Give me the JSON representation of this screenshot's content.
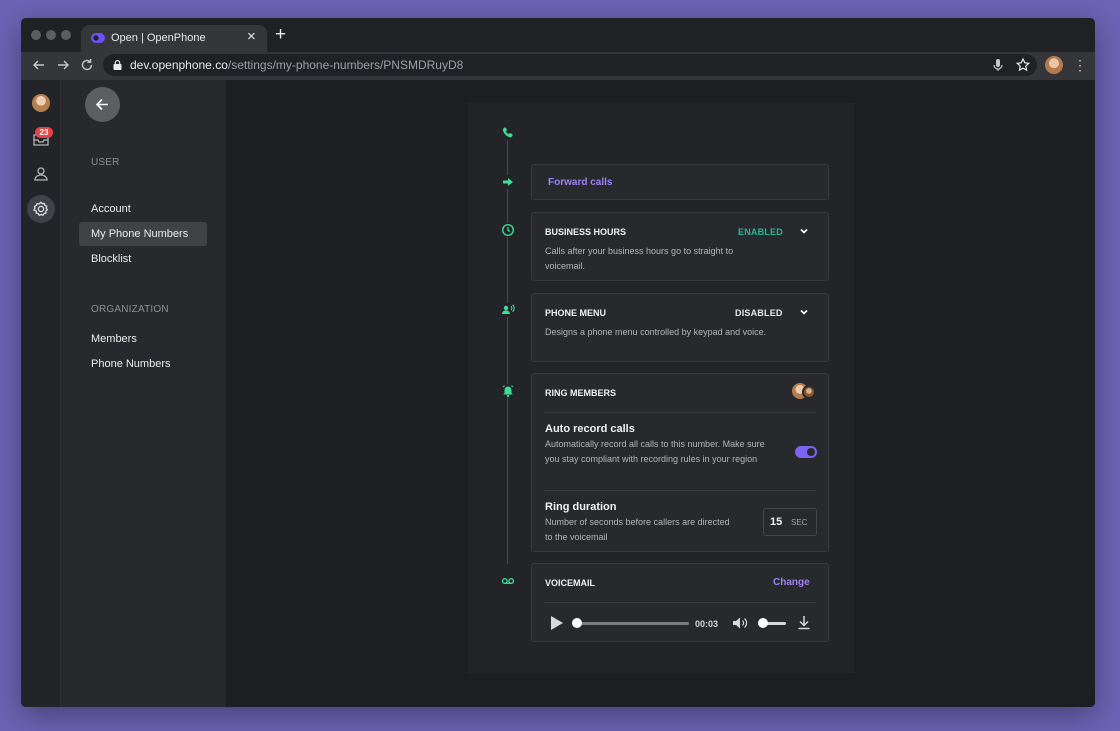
{
  "browser": {
    "tab_title": "Open | OpenPhone",
    "tab_close": "×",
    "new_tab": "+",
    "url_host": "dev.openphone.co",
    "url_path": "/settings/my-phone-numbers/PNSMDRuyD8",
    "kebab": "⋮"
  },
  "rail": {
    "inbox_badge": "23"
  },
  "nav": {
    "user_section": "USER",
    "user_items": [
      "Account",
      "My Phone Numbers",
      "Blocklist"
    ],
    "org_section": "ORGANIZATION",
    "org_items": [
      "Members",
      "Phone Numbers"
    ]
  },
  "flow": {
    "forward": {
      "label": "Forward calls"
    },
    "business_hours": {
      "title": "BUSINESS HOURS",
      "status": "ENABLED",
      "description": "Calls after your business hours go to straight to voicemail."
    },
    "phone_menu": {
      "title": "PHONE MENU",
      "status": "DISABLED",
      "description": "Designs a phone menu controlled by keypad and voice."
    },
    "ring_members": {
      "title": "RING MEMBERS",
      "auto_record": {
        "title": "Auto record calls",
        "description": "Automatically record all calls to this number. Make sure you stay compliant with recording rules in your region",
        "enabled": true
      },
      "ring_duration": {
        "title": "Ring duration",
        "description": "Number of seconds before callers are directed to the voicemail",
        "value": "15",
        "unit": "SEC"
      }
    },
    "voicemail": {
      "title": "VOICEMAIL",
      "change_label": "Change",
      "time": "00:03"
    }
  },
  "colors": {
    "accent_purple": "#9b83f5",
    "status_green": "#2ab891",
    "icon_green": "#3ddc97"
  }
}
